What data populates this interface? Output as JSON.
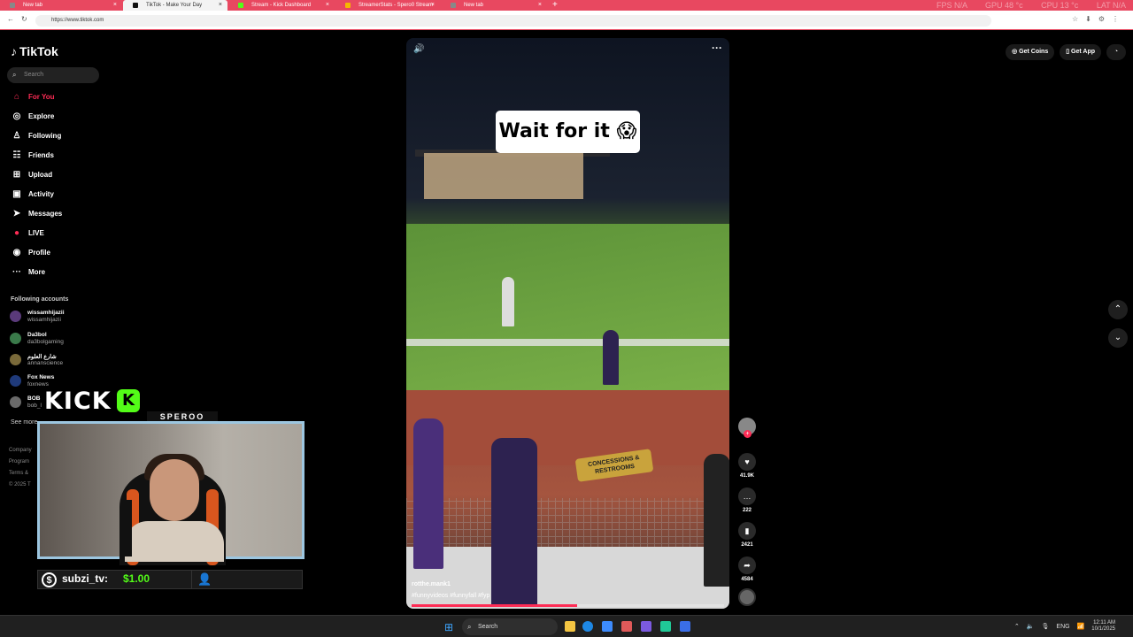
{
  "browser": {
    "tabs": [
      {
        "label": "New tab",
        "fav_color": "#888888"
      },
      {
        "label": "TikTok - Make Your Day",
        "fav_color": "#111111"
      },
      {
        "label": "Stream - Kick Dashboard",
        "fav_color": "#53fc18"
      },
      {
        "label": "StreamerStats - Spero0 Stream",
        "fav_color": "#f5b800"
      },
      {
        "label": "New tab",
        "fav_color": "#888888"
      }
    ],
    "close_glyph": "×",
    "new_tab_glyph": "+",
    "url": "https://www.tiktok.com",
    "sys": {
      "fps": "FPS  N/A",
      "gpu": "GPU  48 °c",
      "cpu": "CPU  13 °c",
      "lat": "LAT  N/A"
    }
  },
  "tiktok": {
    "logo": "TikTok",
    "search_placeholder": "Search",
    "nav": [
      {
        "label": "For You",
        "icon": "home-icon",
        "glyph": "⌂"
      },
      {
        "label": "Explore",
        "icon": "compass-icon",
        "glyph": "◎"
      },
      {
        "label": "Following",
        "icon": "user-plus-icon",
        "glyph": "♙"
      },
      {
        "label": "Friends",
        "icon": "friends-icon",
        "glyph": "☷"
      },
      {
        "label": "Upload",
        "icon": "upload-icon",
        "glyph": "⊞"
      },
      {
        "label": "Activity",
        "icon": "inbox-icon",
        "glyph": "▣"
      },
      {
        "label": "Messages",
        "icon": "send-icon",
        "glyph": "➤"
      },
      {
        "label": "LIVE",
        "icon": "live-icon",
        "glyph": "●"
      },
      {
        "label": "Profile",
        "icon": "profile-icon",
        "glyph": "◉"
      },
      {
        "label": "More",
        "icon": "more-icon",
        "glyph": "···"
      }
    ],
    "following_title": "Following accounts",
    "accounts": [
      {
        "name": "wissamhijazii",
        "handle": "wissamhijazii",
        "color": "#5a3a7a"
      },
      {
        "name": "Da3bol",
        "handle": "da3bolgaming",
        "color": "#3a7a4a"
      },
      {
        "name": "شارع العلوم",
        "handle": "annanscience",
        "color": "#7a6a3a"
      },
      {
        "name": "Fox News",
        "handle": "foxnews",
        "color": "#1f3a7a"
      },
      {
        "name": "BOB",
        "handle": "bob_l",
        "color": "#6a6a6a"
      }
    ],
    "see_more": "See more",
    "footer": [
      "Company",
      "Program",
      "Terms &",
      "© 2025 T"
    ],
    "get_coins": "Get Coins",
    "get_app": "Get App"
  },
  "video": {
    "caption": "Wait for it 😱",
    "sign_text": "CONCESSIONS & RESTROOMS",
    "author": "rotthe.mank1",
    "tags": "#funnyvideos #funnyfall #fyp",
    "progress_pct": 53,
    "likes": "41.9K",
    "comments": "222",
    "saves": "2421",
    "shares": "4584"
  },
  "stream_overlay": {
    "platform": "KICK",
    "streamer_tag": "SPEROO",
    "tip_user": "subzi_tv:",
    "tip_amount": "$1.00"
  },
  "taskbar": {
    "search": "Search",
    "lang": "ENG",
    "time": "12:11 AM",
    "date": "10/1/2025"
  }
}
